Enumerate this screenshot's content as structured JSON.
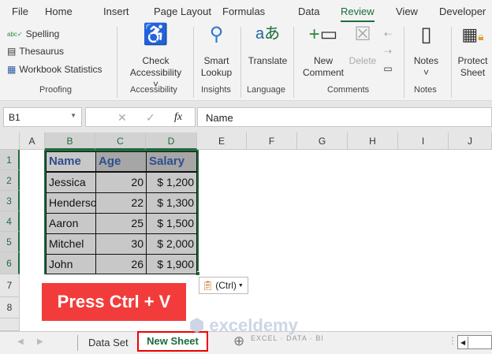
{
  "menu": [
    "File",
    "Home",
    "Insert",
    "Page Layout",
    "Formulas",
    "Data",
    "Review",
    "View",
    "Developer"
  ],
  "active_menu": "Review",
  "ribbon": {
    "proofing": {
      "spelling": "Spelling",
      "thesaurus": "Thesaurus",
      "stats": "Workbook Statistics",
      "label": "Proofing"
    },
    "accessibility": {
      "btn1": "Check",
      "btn2": "Accessibility",
      "label": "Accessibility"
    },
    "insights": {
      "btn1": "Smart",
      "btn2": "Lookup",
      "label": "Insights"
    },
    "language": {
      "btn": "Translate",
      "label": "Language"
    },
    "comments": {
      "new1": "New",
      "new2": "Comment",
      "delete": "Delete",
      "label": "Comments"
    },
    "notes": {
      "btn": "Notes",
      "label": "Notes"
    },
    "protect": {
      "btn1": "Protect",
      "btn2": "Sheet"
    }
  },
  "formula": {
    "name_box": "B1",
    "content": "Name",
    "fx": "fx"
  },
  "columns": [
    "A",
    "B",
    "C",
    "D",
    "E",
    "F",
    "G",
    "H",
    "I",
    "J"
  ],
  "rows": [
    "1",
    "2",
    "3",
    "4",
    "5",
    "6",
    "7",
    "8"
  ],
  "table": {
    "headers": [
      "Name",
      "Age",
      "Salary"
    ],
    "rows": [
      [
        "Jessica",
        "20",
        "$ 1,200"
      ],
      [
        "Henderson",
        "22",
        "$ 1,300"
      ],
      [
        "Aaron",
        "25",
        "$ 1,500"
      ],
      [
        "Mitchel",
        "30",
        "$ 2,000"
      ],
      [
        "John",
        "26",
        "$ 1,900"
      ]
    ]
  },
  "paste_options": "(Ctrl)",
  "callout": "Press Ctrl + V",
  "callout_color": "#f23c3c",
  "sheets": [
    "Data Set",
    "New Sheet"
  ],
  "active_sheet": "New Sheet",
  "watermark": "exceldemy",
  "watermark_sub": "EXCEL · DATA · BI"
}
